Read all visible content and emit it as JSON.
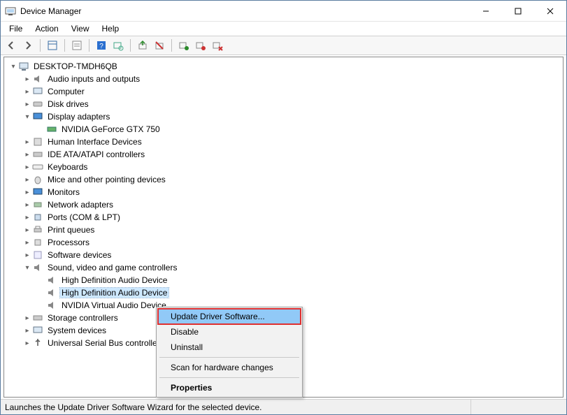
{
  "window": {
    "title": "Device Manager"
  },
  "menu": {
    "file": "File",
    "action": "Action",
    "view": "View",
    "help": "Help"
  },
  "tree": {
    "root": "DESKTOP-TMDH6QB",
    "audio_io": "Audio inputs and outputs",
    "computer": "Computer",
    "disk": "Disk drives",
    "display": "Display adapters",
    "gpu0": "NVIDIA GeForce GTX 750",
    "hid": "Human Interface Devices",
    "ide": "IDE ATA/ATAPI controllers",
    "keyboards": "Keyboards",
    "mice": "Mice and other pointing devices",
    "monitors": "Monitors",
    "netadapters": "Network adapters",
    "ports": "Ports (COM & LPT)",
    "printq": "Print queues",
    "processors": "Processors",
    "softdev": "Software devices",
    "svgc": "Sound, video and game controllers",
    "hda0": "High Definition Audio Device",
    "hda1": "High Definition Audio Device",
    "nvaudio": "NVIDIA Virtual Audio Device",
    "storage": "Storage controllers",
    "sysdev": "System devices",
    "usb": "Universal Serial Bus controllers"
  },
  "context_menu": {
    "update": "Update Driver Software...",
    "disable": "Disable",
    "uninstall": "Uninstall",
    "scan": "Scan for hardware changes",
    "properties": "Properties"
  },
  "status": {
    "text": "Launches the Update Driver Software Wizard for the selected device."
  }
}
